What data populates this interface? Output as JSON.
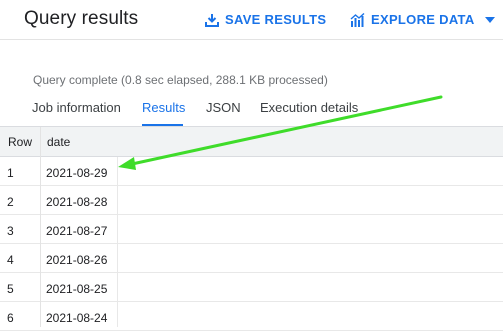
{
  "header": {
    "title": "Query results",
    "save_label": "SAVE RESULTS",
    "explore_label": "EXPLORE DATA"
  },
  "status_text": "Query complete (0.8 sec elapsed, 288.1 KB processed)",
  "tabs": [
    {
      "label": "Job information"
    },
    {
      "label": "Results"
    },
    {
      "label": "JSON"
    },
    {
      "label": "Execution details"
    }
  ],
  "table": {
    "columns": [
      "Row",
      "date"
    ],
    "rows": [
      {
        "row": "1",
        "date": "2021-08-29"
      },
      {
        "row": "2",
        "date": "2021-08-28"
      },
      {
        "row": "3",
        "date": "2021-08-27"
      },
      {
        "row": "4",
        "date": "2021-08-26"
      },
      {
        "row": "5",
        "date": "2021-08-25"
      },
      {
        "row": "6",
        "date": "2021-08-24"
      }
    ]
  },
  "colors": {
    "accent": "#1a73e8",
    "annotation_arrow": "#3fdc2a"
  },
  "icons": [
    "download-icon",
    "chart-icon",
    "caret-down-icon"
  ]
}
